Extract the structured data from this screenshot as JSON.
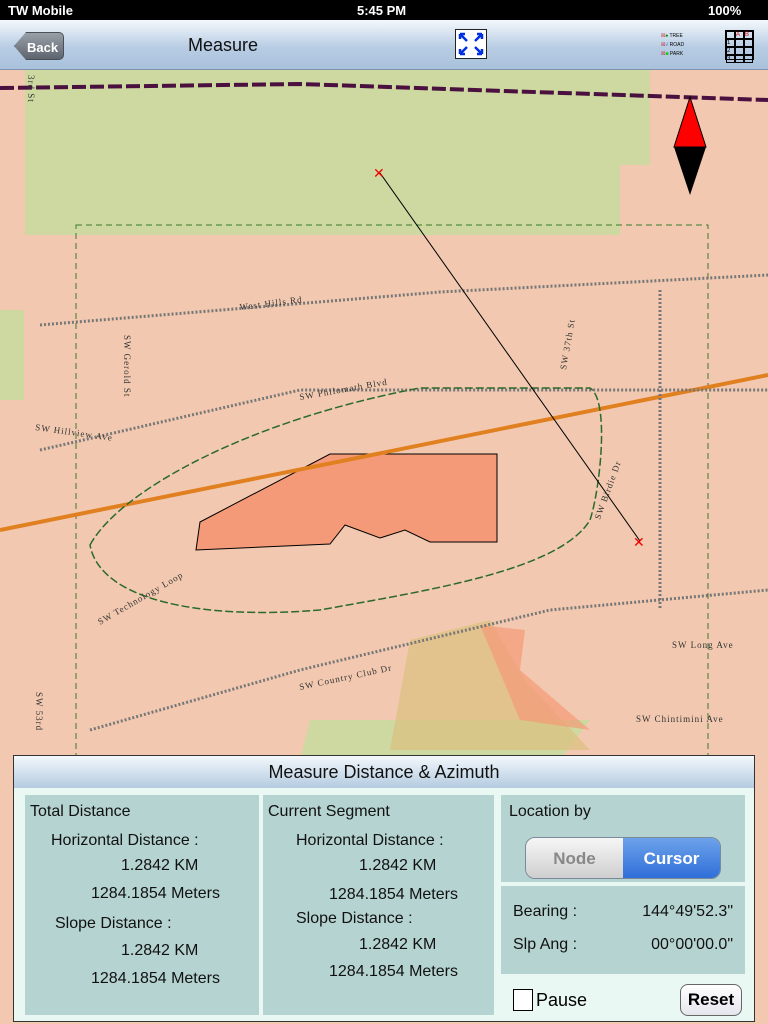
{
  "status": {
    "carrier": "TW Mobile",
    "time": "5:45 PM",
    "battery": "100%"
  },
  "nav": {
    "back": "Back",
    "title": "Measure",
    "legend": [
      "TREE",
      "ROAD",
      "PARK"
    ],
    "grid_cols": [
      "A",
      "B"
    ],
    "grid_rows": [
      "1",
      "2",
      "3"
    ]
  },
  "map": {
    "streets": [
      "3rd St",
      "West Hills Rd",
      "SW Philomath Blvd",
      "SW Hillview Ave",
      "SW Gerold St",
      "SW 37th St",
      "SW Technology Loop",
      "SW Country Club Dr",
      "SW Long Ave",
      "SW Chintimini Ave",
      "SW 53rd",
      "SW Birdie Dr"
    ],
    "colors": {
      "residential": "#f2c9b0",
      "park": "#cdd9a0",
      "building": "#f59a78",
      "measure_line": "#000000",
      "marker": "#e00000"
    }
  },
  "panel": {
    "title": "Measure Distance & Azimuth",
    "total": {
      "heading": "Total Distance",
      "h_label": "Horizontal Distance :",
      "h_km": "1.2842 KM",
      "h_m": "1284.1854 Meters",
      "s_label": "Slope Distance :",
      "s_km": "1.2842 KM",
      "s_m": "1284.1854 Meters"
    },
    "segment": {
      "heading": "Current Segment",
      "h_label": "Horizontal Distance :",
      "h_km": "1.2842 KM",
      "h_m": "1284.1854 Meters",
      "s_label": "Slope Distance :",
      "s_km": "1.2842 KM",
      "s_m": "1284.1854 Meters"
    },
    "location": {
      "heading": "Location by",
      "node": "Node",
      "cursor": "Cursor",
      "selected": "Cursor"
    },
    "bearing_label": "Bearing :",
    "bearing": "144°49'52.3\"",
    "slope_label": "Slp Ang :",
    "slope": "00°00'00.0\"",
    "pause": "Pause",
    "pause_checked": false,
    "reset": "Reset"
  }
}
